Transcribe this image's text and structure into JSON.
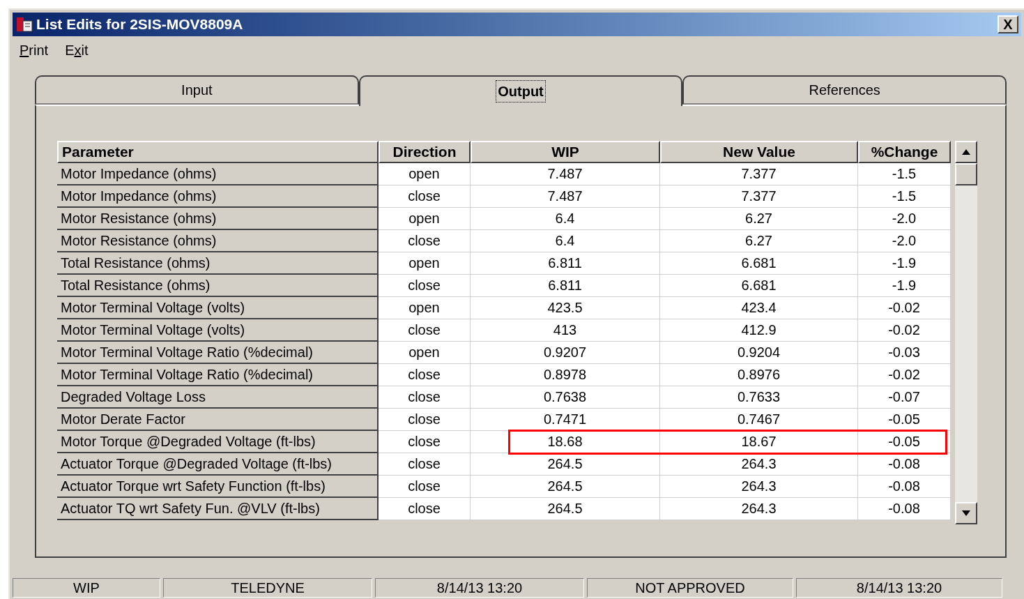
{
  "window": {
    "title": "List Edits for 2SIS-MOV8809A",
    "close": "X"
  },
  "menu": [
    {
      "access_key": "P",
      "rest": "rint"
    },
    {
      "lead": "E",
      "access_key": "x",
      "rest": "it"
    }
  ],
  "tabs": [
    {
      "label": "Input",
      "selected": false
    },
    {
      "label": "Output",
      "selected": true
    },
    {
      "label": "References",
      "selected": false
    }
  ],
  "table": {
    "columns": [
      "Parameter",
      "Direction",
      "WIP",
      "New Value",
      "%Change"
    ],
    "rows": [
      {
        "cells": [
          "Motor Impedance (ohms)",
          "open",
          "7.487",
          "7.377",
          "-1.5"
        ],
        "highlighted": false
      },
      {
        "cells": [
          "Motor Impedance (ohms)",
          "close",
          "7.487",
          "7.377",
          "-1.5"
        ],
        "highlighted": false
      },
      {
        "cells": [
          "Motor Resistance (ohms)",
          "open",
          "6.4",
          "6.27",
          "-2.0"
        ],
        "highlighted": false
      },
      {
        "cells": [
          "Motor Resistance (ohms)",
          "close",
          "6.4",
          "6.27",
          "-2.0"
        ],
        "highlighted": false
      },
      {
        "cells": [
          "Total Resistance (ohms)",
          "open",
          "6.811",
          "6.681",
          "-1.9"
        ],
        "highlighted": false
      },
      {
        "cells": [
          "Total Resistance (ohms)",
          "close",
          "6.811",
          "6.681",
          "-1.9"
        ],
        "highlighted": false
      },
      {
        "cells": [
          "Motor Terminal Voltage (volts)",
          "open",
          "423.5",
          "423.4",
          "-0.02"
        ],
        "highlighted": false
      },
      {
        "cells": [
          "Motor Terminal Voltage (volts)",
          "close",
          "413",
          "412.9",
          "-0.02"
        ],
        "highlighted": false
      },
      {
        "cells": [
          "Motor Terminal Voltage Ratio (%decimal)",
          "open",
          "0.9207",
          "0.9204",
          "-0.03"
        ],
        "highlighted": false
      },
      {
        "cells": [
          "Motor Terminal Voltage Ratio (%decimal)",
          "close",
          "0.8978",
          "0.8976",
          "-0.02"
        ],
        "highlighted": false
      },
      {
        "cells": [
          "Degraded Voltage Loss",
          "close",
          "0.7638",
          "0.7633",
          "-0.07"
        ],
        "highlighted": false
      },
      {
        "cells": [
          "Motor Derate Factor",
          "close",
          "0.7471",
          "0.7467",
          "-0.05"
        ],
        "highlighted": false
      },
      {
        "cells": [
          "Motor Torque @Degraded Voltage (ft-lbs)",
          "close",
          "18.68",
          "18.67",
          "-0.05"
        ],
        "highlighted": true
      },
      {
        "cells": [
          "Actuator Torque @Degraded Voltage (ft-lbs)",
          "close",
          "264.5",
          "264.3",
          "-0.08"
        ],
        "highlighted": false
      },
      {
        "cells": [
          "Actuator Torque wrt Safety Function (ft-lbs)",
          "close",
          "264.5",
          "264.3",
          "-0.08"
        ],
        "highlighted": false
      },
      {
        "cells": [
          "Actuator TQ wrt Safety Fun. @VLV (ft-lbs)",
          "close",
          "264.5",
          "264.3",
          "-0.08"
        ],
        "highlighted": false
      }
    ]
  },
  "status_bar": [
    "WIP",
    "TELEDYNE",
    "8/14/13 13:20",
    "NOT APPROVED",
    "8/14/13 13:20"
  ]
}
